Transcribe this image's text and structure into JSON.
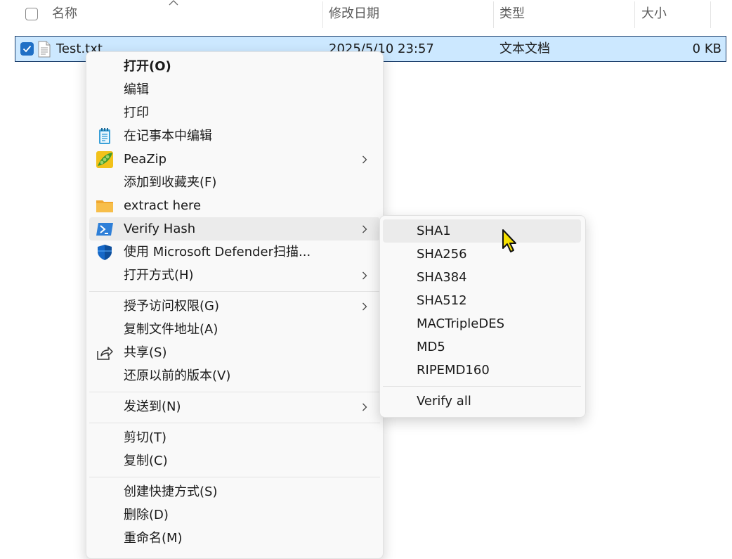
{
  "header": {
    "name_label": "名称",
    "date_label": "修改日期",
    "type_label": "类型",
    "size_label": "大小"
  },
  "file": {
    "name": "Test.txt",
    "modified": "2025/5/10 23:57",
    "type": "文本文档",
    "size": "0 KB",
    "selected": true
  },
  "context_menu": {
    "items": [
      {
        "label": "打开(O)",
        "icon": "",
        "bold": true
      },
      {
        "label": "编辑",
        "icon": ""
      },
      {
        "label": "打印",
        "icon": ""
      },
      {
        "label": "在记事本中编辑",
        "icon": "notepad-icon"
      },
      {
        "label": "PeaZip",
        "icon": "peazip-icon",
        "submenu": true
      },
      {
        "label": "添加到收藏夹(F)",
        "icon": ""
      },
      {
        "label": "extract here",
        "icon": "folder-icon"
      },
      {
        "label": "Verify Hash",
        "icon": "powershell-icon",
        "submenu": true,
        "highlighted": true
      },
      {
        "label": "使用 Microsoft Defender扫描...",
        "icon": "defender-shield-icon"
      },
      {
        "label": "打开方式(H)",
        "icon": "",
        "submenu": true
      },
      {
        "label": "授予访问权限(G)",
        "icon": "",
        "submenu": true
      },
      {
        "label": "复制文件地址(A)",
        "icon": ""
      },
      {
        "label": "共享(S)",
        "icon": "share-icon"
      },
      {
        "label": "还原以前的版本(V)",
        "icon": ""
      },
      {
        "label": "发送到(N)",
        "icon": "",
        "submenu": true
      },
      {
        "label": "剪切(T)",
        "icon": ""
      },
      {
        "label": "复制(C)",
        "icon": ""
      },
      {
        "label": "创建快捷方式(S)",
        "icon": ""
      },
      {
        "label": "删除(D)",
        "icon": ""
      },
      {
        "label": "重命名(M)",
        "icon": ""
      }
    ]
  },
  "submenu": {
    "items": [
      {
        "label": "SHA1",
        "highlighted": true
      },
      {
        "label": "SHA256"
      },
      {
        "label": "SHA384"
      },
      {
        "label": "SHA512"
      },
      {
        "label": "MACTripleDES"
      },
      {
        "label": "MD5"
      },
      {
        "label": "RIPEMD160"
      },
      {
        "label": "Verify all"
      }
    ]
  },
  "colors": {
    "selection_bg": "#cce8ff",
    "checkbox_accent": "#1f6fc5",
    "menu_bg": "#f9f9f9",
    "hover_bg": "#ebebeb"
  }
}
